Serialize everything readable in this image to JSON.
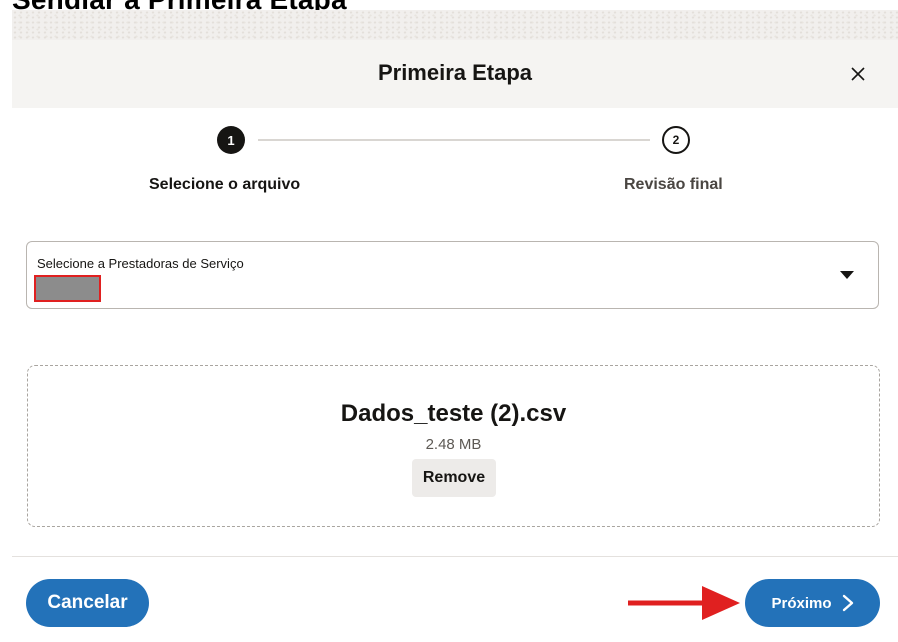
{
  "document": {
    "caption": "Sehdlar a Primeira Etapa"
  },
  "dialog": {
    "title": "Primeira Etapa",
    "close_icon": "close-icon"
  },
  "stepper": {
    "steps": [
      {
        "number": "1",
        "label": "Selecione o arquivo",
        "state": "active"
      },
      {
        "number": "2",
        "label": "Revisão final",
        "state": "pending"
      }
    ]
  },
  "provider_select": {
    "label": "Selecione a Prestadoras de Serviço",
    "value_redacted": true,
    "arrow_icon": "caret-down-icon"
  },
  "upload": {
    "file_name": "Dados_teste (2).csv",
    "file_size": "2.48 MB",
    "remove_label": "Remove"
  },
  "footer": {
    "cancel_label": "Cancelar",
    "next_label": "Próximo",
    "next_icon": "chevron-right-icon"
  },
  "colors": {
    "primary_button": "#2372b9",
    "annotation_arrow": "#e02020",
    "highlight_border": "#e02020"
  }
}
